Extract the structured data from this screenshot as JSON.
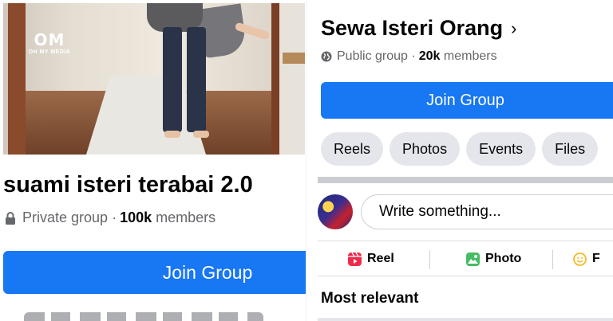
{
  "left": {
    "cover": {
      "logo_text": "OM",
      "logo_sub": "OH MY MEDIA"
    },
    "group_name": "suami isteri terabai 2.0",
    "privacy": "Private group",
    "separator": "·",
    "member_count": "100k",
    "members_label": "members",
    "join_label": "Join Group"
  },
  "right": {
    "group_name": "Sewa Isteri Orang",
    "chevron": "›",
    "privacy": "Public group",
    "separator": "·",
    "member_count": "20k",
    "members_label": "members",
    "join_label": "Join Group",
    "tabs": [
      "Reels",
      "Photos",
      "Events",
      "Files"
    ],
    "composer_placeholder": "Write something...",
    "actions": {
      "reel": "Reel",
      "photo": "Photo",
      "feeling": "F"
    },
    "sort_label": "Most relevant"
  },
  "colors": {
    "primary": "#1877f2",
    "chip_bg": "#e4e6eb",
    "meta_text": "#65676b",
    "reel_icon": "#f02849",
    "photo_icon": "#45bd62",
    "feeling_icon": "#f7b928"
  },
  "icons": {
    "private": "lock-icon",
    "public": "globe-icon",
    "reel": "reel-icon",
    "photo": "photo-icon",
    "feeling": "feeling-icon",
    "chevron": "chevron-right-icon"
  }
}
